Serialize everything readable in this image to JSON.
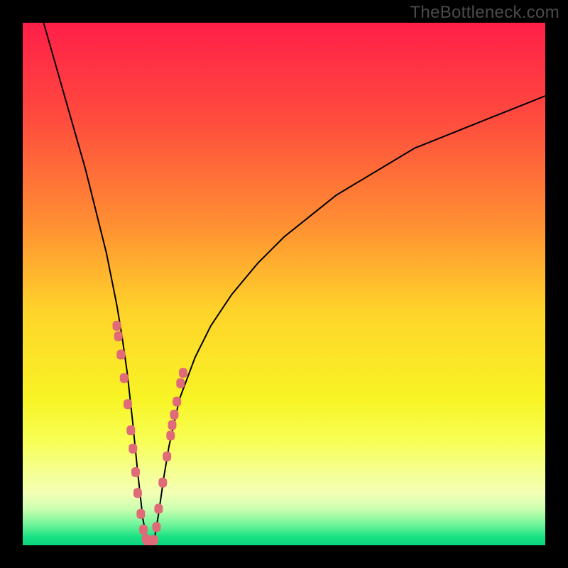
{
  "watermark": "TheBottleneck.com",
  "chart_data": {
    "type": "line",
    "title": "",
    "xlabel": "",
    "ylabel": "",
    "xlim": [
      0,
      100
    ],
    "ylim": [
      0,
      100
    ],
    "grid": false,
    "legend": false,
    "background_gradient_stops": [
      {
        "offset": 0.0,
        "color": "#ff1f49"
      },
      {
        "offset": 0.18,
        "color": "#ff4a3e"
      },
      {
        "offset": 0.38,
        "color": "#ff8d33"
      },
      {
        "offset": 0.55,
        "color": "#ffd32a"
      },
      {
        "offset": 0.72,
        "color": "#f8f425"
      },
      {
        "offset": 0.8,
        "color": "#f8ff55"
      },
      {
        "offset": 0.86,
        "color": "#f5ff92"
      },
      {
        "offset": 0.9,
        "color": "#f3ffb5"
      },
      {
        "offset": 0.93,
        "color": "#ccffb0"
      },
      {
        "offset": 0.96,
        "color": "#72f59a"
      },
      {
        "offset": 0.985,
        "color": "#17e084"
      },
      {
        "offset": 1.0,
        "color": "#0bd57d"
      }
    ],
    "series": [
      {
        "name": "bottleneck-curve",
        "stroke": "#000000",
        "stroke_width": 2,
        "x": [
          4,
          6,
          8,
          10,
          12,
          14,
          16,
          18,
          19,
          20,
          21,
          22,
          23,
          24,
          25,
          26,
          27,
          28,
          30,
          33,
          36,
          40,
          45,
          50,
          55,
          60,
          65,
          70,
          75,
          80,
          85,
          90,
          95,
          100
        ],
        "y": [
          100,
          93,
          86,
          79,
          72,
          64,
          56,
          46,
          40,
          33,
          24,
          14,
          5,
          0,
          0,
          6,
          13,
          19,
          28,
          36,
          42,
          48,
          54,
          59,
          63,
          67,
          70,
          73,
          76,
          78,
          80,
          82,
          84,
          86
        ]
      },
      {
        "name": "sample-markers",
        "type": "scatter",
        "marker_shape": "rounded-rect",
        "marker_color": "#e06b78",
        "x": [
          18.0,
          18.3,
          18.8,
          19.4,
          20.1,
          20.7,
          21.1,
          21.6,
          22.0,
          22.6,
          23.1,
          23.6,
          24.0,
          24.6,
          25.1,
          25.6,
          26.0,
          26.8,
          27.6,
          28.3,
          28.6,
          29.0,
          29.5,
          30.2,
          30.7
        ],
        "y": [
          42.0,
          40.0,
          36.5,
          32.0,
          27.0,
          22.0,
          18.5,
          14.0,
          10.0,
          6.0,
          3.0,
          1.2,
          0.5,
          0.5,
          1.0,
          3.5,
          7.0,
          12.0,
          17.0,
          21.0,
          23.0,
          25.0,
          27.5,
          31.0,
          33.0
        ]
      }
    ]
  }
}
